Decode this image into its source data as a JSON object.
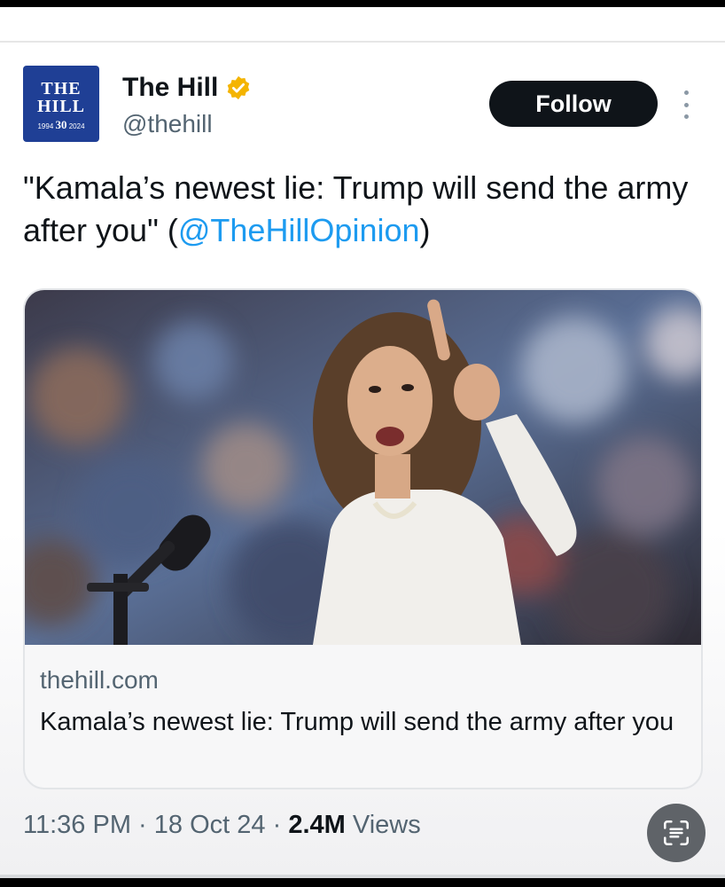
{
  "author": {
    "avatar_line1": "THE",
    "avatar_line2": "HILL",
    "avatar_year_start": "1994",
    "avatar_anniversary": "30",
    "avatar_year_end": "2024",
    "display_name": "The Hill",
    "handle": "@thehill",
    "verified_icon": "verified-badge-icon",
    "verified_color": "#f4b400"
  },
  "actions": {
    "follow_label": "Follow",
    "more_icon": "more-vertical-icon"
  },
  "tweet": {
    "text_before": "\"Kamala’s newest lie: Trump will send the army after you\" (",
    "mention": "@TheHillOpinion",
    "text_after": ")"
  },
  "link_card": {
    "domain": "thehill.com",
    "title": "Kamala’s newest lie: Trump will send the army after you",
    "image_icon": "news-photo"
  },
  "meta": {
    "time": "11:36 PM",
    "separator": "·",
    "date": "18 Oct 24",
    "views_count": "2.4M",
    "views_label": "Views"
  },
  "colors": {
    "accent_link": "#1d9bf0",
    "follow_bg": "#0f1419",
    "avatar_bg": "#1f3f95"
  },
  "overlay": {
    "scan_icon": "text-scan-icon"
  }
}
